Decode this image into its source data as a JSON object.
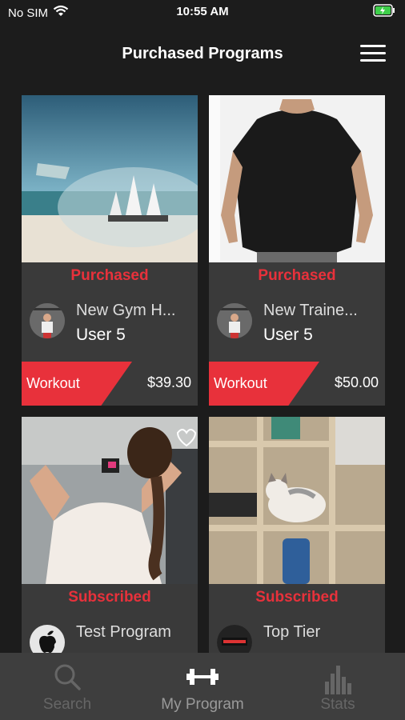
{
  "status_bar": {
    "carrier": "No SIM",
    "time": "10:55 AM"
  },
  "header": {
    "title": "Purchased Programs"
  },
  "cards": [
    {
      "status": "Purchased",
      "name": "New Gym H...",
      "user": "User 5",
      "tag": "Workout",
      "price": "$39.30",
      "image": "ship-in-bottle-on-beach"
    },
    {
      "status": "Purchased",
      "name": "New Traine...",
      "user": "User 5",
      "tag": "Workout",
      "price": "$50.00",
      "image": "man-in-black-tshirt"
    },
    {
      "status": "Subscribed",
      "name": "Test Program",
      "user": "",
      "image": "woman-stretching-in-gym"
    },
    {
      "status": "Subscribed",
      "name": "Top Tier",
      "user": "",
      "image": "cat-on-shelf"
    }
  ],
  "tabs": [
    {
      "label": "Search",
      "icon": "search-icon"
    },
    {
      "label": "My Program",
      "icon": "dumbbell-icon"
    },
    {
      "label": "Stats",
      "icon": "bar-chart-icon"
    }
  ],
  "colors": {
    "accent": "#e8313b",
    "background": "#1c1c1c",
    "card": "#3a3a3a",
    "tab_bar": "#3e3e3e"
  }
}
